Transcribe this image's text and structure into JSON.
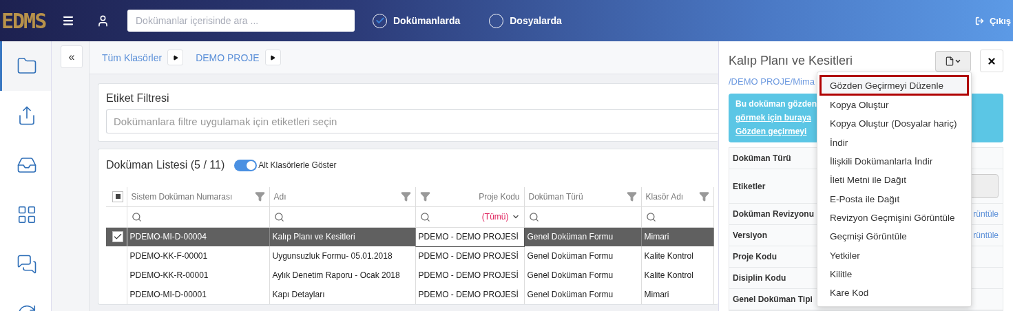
{
  "header": {
    "logo": "EDMS",
    "search_placeholder": "Dokümanlar içerisinde ara ...",
    "scopes": [
      {
        "label": "Dokümanlarda",
        "selected": true
      },
      {
        "label": "Dosyalarda",
        "selected": false
      }
    ],
    "logout": "Çıkış"
  },
  "sidebar": {
    "items": [
      {
        "selected": true
      },
      {
        "selected": false
      },
      {
        "selected": false
      },
      {
        "selected": false
      },
      {
        "selected": false
      },
      {
        "selected": false
      }
    ]
  },
  "collapse_button": "«",
  "breadcrumb": [
    "Tüm Klasörler",
    "DEMO PROJE"
  ],
  "tag_filter": {
    "title": "Etiket Filtresi",
    "placeholder": "Dokümanlara filtre uygulamak için etiketleri seçin"
  },
  "document_list": {
    "title": "Doküman Listesi (5 / 11)",
    "toggle": {
      "label": "Alt Klasörlerle Göster",
      "on": true
    },
    "select_all_partial": true,
    "columns": [
      {
        "label": "Sistem Doküman Numarası",
        "filter_icon_left": false
      },
      {
        "label": "Adı",
        "filter_icon_left": false
      },
      {
        "label": "Proje Kodu",
        "filter_icon_left": true,
        "filter_value": "(Tümü)"
      },
      {
        "label": "Doküman Türü",
        "filter_icon_left": false
      },
      {
        "label": "Klasör Adı",
        "filter_icon_left": false
      }
    ],
    "rows": [
      {
        "selected": true,
        "cells": [
          {
            "text": "PDEMO-MI-D-00004",
            "focused": false
          },
          {
            "text": "Kalıp Planı ve Kesitleri",
            "focused": false
          },
          {
            "text": "PDEMO - DEMO PROJESİ",
            "focused": true
          },
          {
            "text": "Genel Doküman Formu",
            "focused": false
          },
          {
            "text": "Mimari",
            "focused": false
          }
        ]
      },
      {
        "selected": false,
        "cells": [
          {
            "text": "PDEMO-KK-F-00001",
            "focused": false
          },
          {
            "text": "Uygunsuzluk Formu- 05.01.2018",
            "focused": false
          },
          {
            "text": "PDEMO - DEMO PROJESİ",
            "focused": false
          },
          {
            "text": "Genel Doküman Formu",
            "focused": false
          },
          {
            "text": "Kalite Kontrol",
            "focused": false
          }
        ]
      },
      {
        "selected": false,
        "cells": [
          {
            "text": "PDEMO-KK-R-00001",
            "focused": false
          },
          {
            "text": "Aylık Denetim Raporu - Ocak 2018",
            "focused": false
          },
          {
            "text": "PDEMO - DEMO PROJESİ",
            "focused": false
          },
          {
            "text": "Genel Doküman Formu",
            "focused": false
          },
          {
            "text": "Kalite Kontrol",
            "focused": false
          }
        ]
      },
      {
        "selected": false,
        "cells": [
          {
            "text": "PDEMO-MI-D-00001",
            "focused": false
          },
          {
            "text": "Kapı Detayları",
            "focused": false
          },
          {
            "text": "PDEMO - DEMO PROJESİ",
            "focused": false
          },
          {
            "text": "Genel Doküman Formu",
            "focused": false
          },
          {
            "text": "Mimari",
            "focused": false
          }
        ]
      }
    ]
  },
  "detail_panel": {
    "title": "Kalıp Planı ve Kesitleri",
    "path": "/DEMO PROJE/Mima",
    "alert_lines": [
      {
        "text": "Bu doküman gözden",
        "underline": false
      },
      {
        "text": "görmek için buraya",
        "underline": true
      },
      {
        "text": "Gözden geçirmeyi",
        "underline": true
      }
    ],
    "fields": [
      {
        "label": "Doküman Türü",
        "kind": "text"
      },
      {
        "label": "Etiketler",
        "kind": "input"
      },
      {
        "label": "Doküman Revizyonu",
        "kind": "link",
        "value": "rüntüle"
      },
      {
        "label": "Versiyon",
        "kind": "link",
        "value": "rüntüle"
      },
      {
        "label": "Proje Kodu",
        "kind": "text"
      },
      {
        "label": "Disiplin Kodu",
        "kind": "text"
      },
      {
        "label": "Genel Doküman Tipi",
        "kind": "text"
      }
    ],
    "menu": [
      {
        "label": "Gözden Geçirmeyi Düzenle",
        "selected": true
      },
      {
        "label": "Kopya Oluştur",
        "selected": false
      },
      {
        "label": "Kopya Oluştur (Dosyalar hariç)",
        "selected": false
      },
      {
        "label": "İndir",
        "selected": false
      },
      {
        "label": "İlişkili Dokümanlarla İndir",
        "selected": false
      },
      {
        "label": "İleti Metni ile Dağıt",
        "selected": false
      },
      {
        "label": "E-Posta ile Dağıt",
        "selected": false
      },
      {
        "label": "Revizyon Geçmişini Görüntüle",
        "selected": false
      },
      {
        "label": "Geçmişi Görüntüle",
        "selected": false
      },
      {
        "label": "Yetkiler",
        "selected": false
      },
      {
        "label": "Kilitle",
        "selected": false
      },
      {
        "label": "Kare Kod",
        "selected": false
      }
    ]
  }
}
